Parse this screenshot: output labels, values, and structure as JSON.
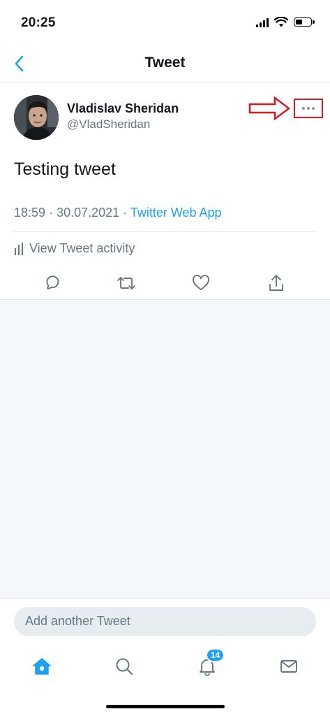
{
  "status_bar": {
    "time": "20:25"
  },
  "nav": {
    "title": "Tweet",
    "back_icon": "chevron-left-icon"
  },
  "tweet": {
    "author_name": "Vladislav Sheridan",
    "author_handle": "@VladSheridan",
    "text": "Testing tweet",
    "time": "18:59",
    "date": "30.07.2021",
    "source": "Twitter Web App",
    "activity_label": "View Tweet activity",
    "actions": [
      "reply-icon",
      "retweet-icon",
      "like-icon",
      "share-icon"
    ]
  },
  "compose": {
    "placeholder": "Add another Tweet"
  },
  "tabbar": {
    "items": [
      "home-icon",
      "search-icon",
      "notifications-icon",
      "messages-icon"
    ],
    "notifications_count": "14"
  },
  "colors": {
    "accent": "#1da1f2",
    "annotation": "#e0151f",
    "secondary_text": "#657786",
    "background_gray": "#f5f8fa"
  }
}
